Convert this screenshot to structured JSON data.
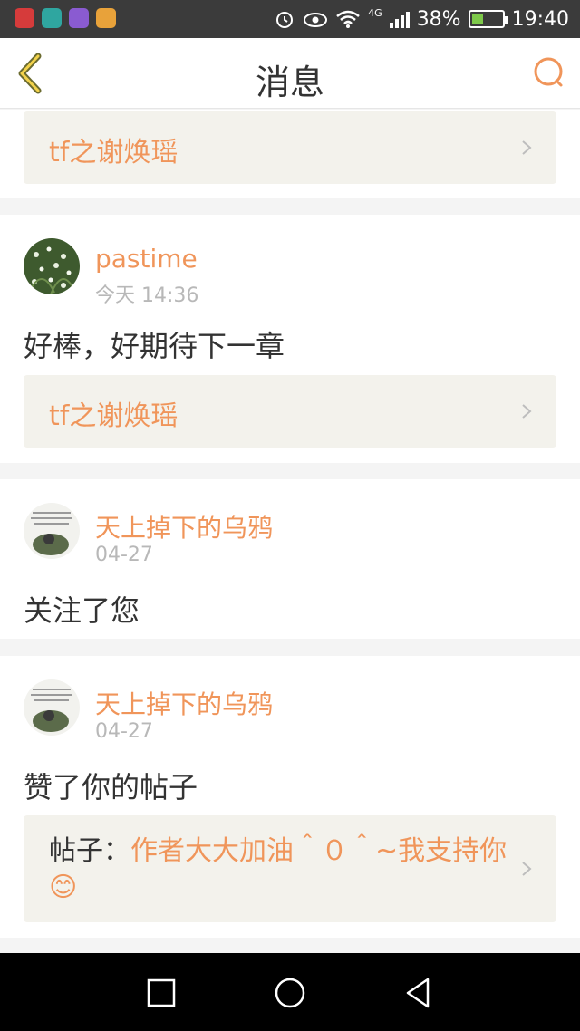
{
  "status_bar": {
    "network": "4G",
    "battery": "38%",
    "battery_level": 0.38,
    "time": "19:40",
    "icons": [
      "alarm-icon",
      "eye-icon",
      "wifi-icon",
      "signal-icon",
      "battery-icon"
    ]
  },
  "header": {
    "title": "消息",
    "back_icon": "chevron-left-icon",
    "search_icon": "search-icon"
  },
  "messages": [
    {
      "link": "tf之谢焕瑶"
    },
    {
      "username": "pastime",
      "time": "今天 14:36",
      "text": "好棒，好期待下一章",
      "link": "tf之谢焕瑶"
    },
    {
      "username": "天上掉下的乌鸦",
      "time": "04-27",
      "text": "关注了您"
    },
    {
      "username": "天上掉下的乌鸦",
      "time": "04-27",
      "text": "赞了你的帖子",
      "post_label": "帖子：",
      "post_title": "作者大大加油＾０＾~我支持你😊"
    }
  ],
  "nav": {
    "icons": [
      "recent-apps-icon",
      "home-icon",
      "back-icon"
    ]
  },
  "colors": {
    "accent": "#f0955a",
    "status_bar": "#3b3b3b",
    "card_box": "#f3f2ec"
  }
}
